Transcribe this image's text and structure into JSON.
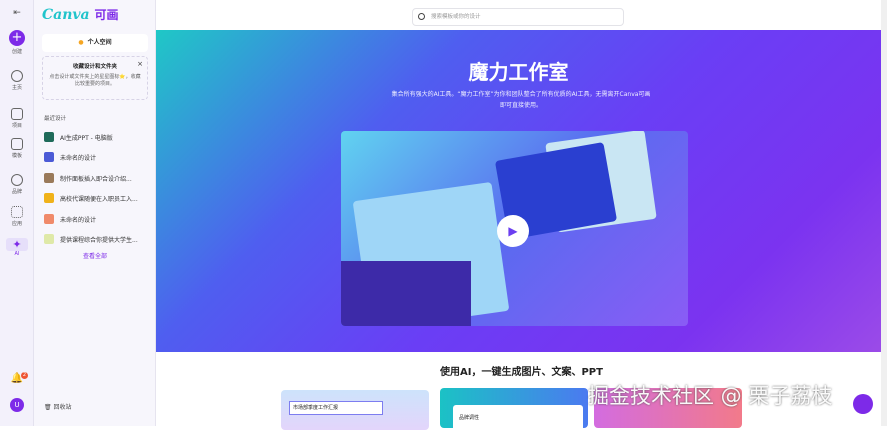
{
  "rail": {
    "items": [
      {
        "label": "创建"
      },
      {
        "label": "主页"
      },
      {
        "label": "项目"
      },
      {
        "label": "模板"
      },
      {
        "label": "品牌"
      },
      {
        "label": "应用"
      },
      {
        "label": "AI"
      }
    ],
    "notification_count": "2",
    "avatar": "U"
  },
  "panel": {
    "logo": "Canva",
    "logo_cn": "可画",
    "team": "个人空间",
    "card_title": "收藏设计和文件夹",
    "card_text": "点击设计或文件夹上的星星图标⭐，收藏比较重要的项目。",
    "card_close": "×",
    "recent_label": "最近设计",
    "recent": [
      {
        "name": "AI生成PPT - 电脑版",
        "color": "#1f6b5a"
      },
      {
        "name": "未命名的设计",
        "color": "#4c5bd6"
      },
      {
        "name": "制作面板插入即合设介绍...",
        "color": "#9a7a5a"
      },
      {
        "name": "高校代课随便在入职员工入...",
        "color": "#f0b21a"
      },
      {
        "name": "未命名的设计",
        "color": "#f08a6a"
      },
      {
        "name": "提供课程综合你提供大学生...",
        "color": "#dfe9a8"
      }
    ],
    "view_all": "查看全部",
    "trash": "回收站"
  },
  "main": {
    "search_placeholder": "搜索模板或你的设计",
    "hero_title": "魔力工作室",
    "hero_desc": "集合所有强大的AI工具。“魔力工作室”为你和团队整合了所有优质的AI工具，无需离开Canva可画即可直接使用。",
    "subtitle": "使用AI，一键生成图片、文案、PPT",
    "card1_input": "市场部季度工作汇报",
    "card2_label": "品牌调性"
  },
  "watermark": "掘金技术社区 @ 栗子荔枝"
}
